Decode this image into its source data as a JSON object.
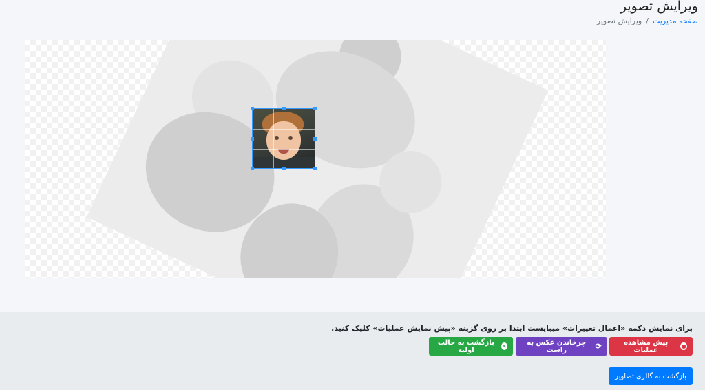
{
  "header": {
    "title": "ویرایش تصویر",
    "breadcrumb": {
      "home_link": "صفحه مدیریت",
      "separator": "/",
      "current": "ویرایش تصویر"
    }
  },
  "editor": {
    "image_description": "rotated family photo with crop selection",
    "colors": {
      "crop_border": "#3399ff"
    }
  },
  "footer": {
    "hint": "برای نمایش دکمه «اعمال تغییرات» میبایست ابتدا بر روی گزینه «پیش نمایش عملیات» کلیک کنید.",
    "buttons": {
      "preview": {
        "label": "پیش مشاهده عملیات",
        "icon": "eye-icon",
        "color": "#dc3545"
      },
      "rotate": {
        "label": "چرخاندن عکس به راست",
        "icon": "sync-icon",
        "color": "#6f42c1"
      },
      "reset": {
        "label": "بازگشت به حالت اولیه",
        "icon": "close-circle-icon",
        "color": "#28a745"
      },
      "back": {
        "label": "بازگشت به گالری تصاویر",
        "color": "#007bff"
      }
    }
  }
}
